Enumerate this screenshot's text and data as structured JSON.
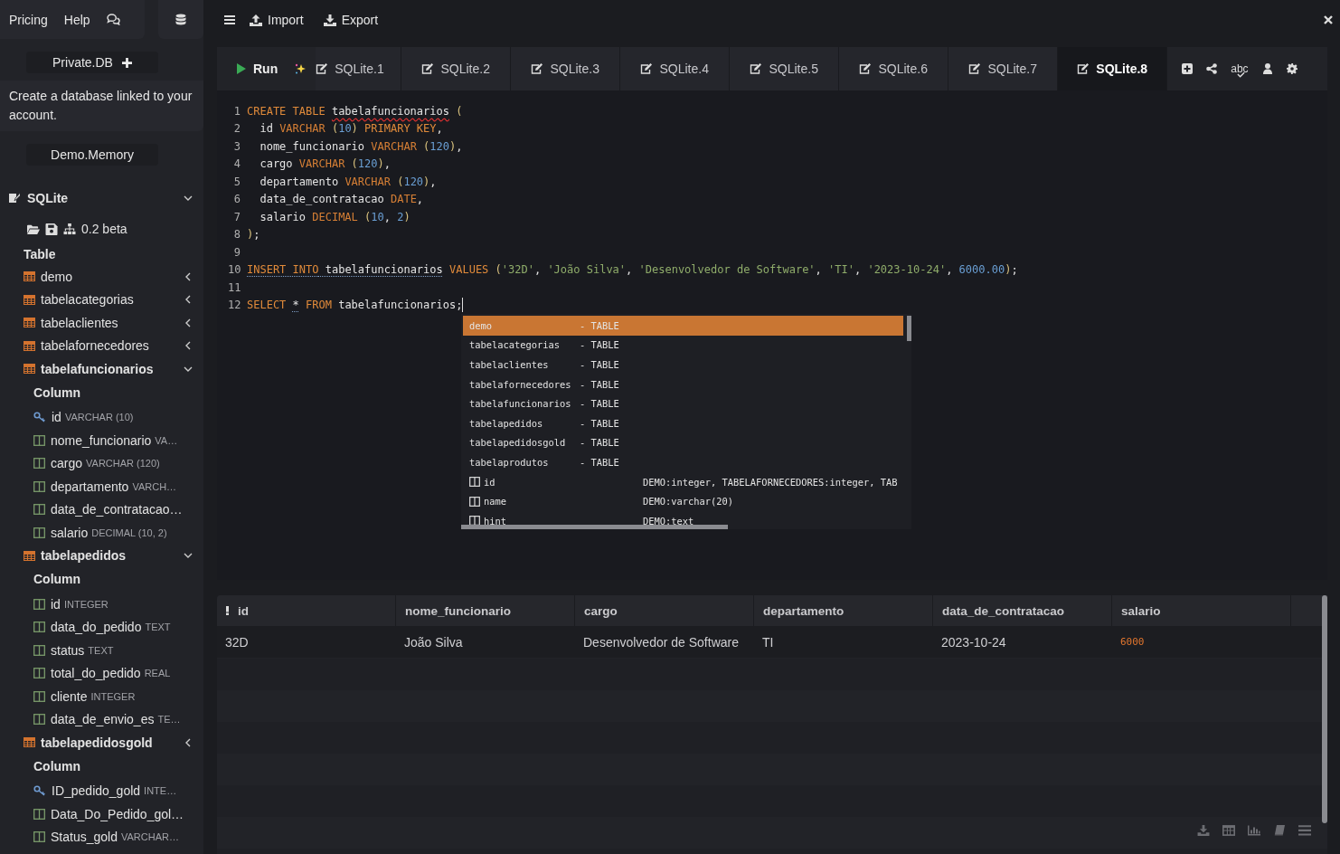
{
  "sidebar": {
    "links": [
      "Pricing",
      "Help"
    ],
    "private_db": {
      "label": "Private.DB",
      "description": "Create a database linked to your account."
    },
    "demo_button": "Demo.Memory",
    "database": {
      "name": "SQLite",
      "expanded": true,
      "version": "0.2 beta",
      "section": "Table",
      "tables": [
        {
          "name": "demo",
          "expanded": false
        },
        {
          "name": "tabelacategorias",
          "expanded": false
        },
        {
          "name": "tabelaclientes",
          "expanded": false
        },
        {
          "name": "tabelafornecedores",
          "expanded": false
        },
        {
          "name": "tabelafuncionarios",
          "expanded": true,
          "column_header": "Column",
          "columns": [
            {
              "name": "id",
              "type": "VARCHAR (10)",
              "key": true
            },
            {
              "name": "nome_funcionario",
              "type": "VA…",
              "key": false
            },
            {
              "name": "cargo",
              "type": "VARCHAR (120)",
              "key": false
            },
            {
              "name": "departamento",
              "type": "VARCH…",
              "key": false
            },
            {
              "name": "data_de_contratacao…",
              "key": false
            },
            {
              "name": "salario",
              "type": "DECIMAL (10, 2)",
              "key": false
            }
          ]
        },
        {
          "name": "tabelapedidos",
          "expanded": true,
          "column_header": "Column",
          "columns": [
            {
              "name": "id",
              "type": "INTEGER",
              "key": false
            },
            {
              "name": "data_do_pedido",
              "type": "TEXT",
              "key": false
            },
            {
              "name": "status",
              "type": "TEXT",
              "key": false
            },
            {
              "name": "total_do_pedido",
              "type": "REAL",
              "key": false
            },
            {
              "name": "cliente",
              "type": "INTEGER",
              "key": false
            },
            {
              "name": "data_de_envio_es",
              "type": "TE…",
              "key": false
            }
          ]
        },
        {
          "name": "tabelapedidosgold",
          "expanded": false,
          "column_header": "Column",
          "columns": [
            {
              "name": "ID_pedido_gold",
              "type": "INTE…",
              "key": true
            },
            {
              "name": "Data_Do_Pedido_gol…",
              "key": false
            },
            {
              "name": "Status_gold",
              "type": "VARCHAR…",
              "key": false
            }
          ]
        }
      ]
    }
  },
  "toolbar": {
    "import": "Import",
    "export": "Export"
  },
  "editor": {
    "run": "Run",
    "spellcheck": "abc",
    "tabs": [
      {
        "label": "SQLite.1",
        "selected": false
      },
      {
        "label": "SQLite.2",
        "selected": false
      },
      {
        "label": "SQLite.3",
        "selected": false
      },
      {
        "label": "SQLite.4",
        "selected": false
      },
      {
        "label": "SQLite.5",
        "selected": false
      },
      {
        "label": "SQLite.6",
        "selected": false
      },
      {
        "label": "SQLite.7",
        "selected": false
      },
      {
        "label": "SQLite.8",
        "selected": true
      }
    ],
    "lines": [
      {
        "n": "1",
        "tokens": [
          {
            "t": "CREATE TABLE ",
            "kind": "keyword"
          },
          {
            "t": "tabelafuncionarios",
            "kind": "plain",
            "error": true
          },
          {
            "t": " (",
            "kind": "paren"
          }
        ]
      },
      {
        "n": "2",
        "tokens": [
          {
            "t": "  id ",
            "kind": "plain"
          },
          {
            "t": "VARCHAR ",
            "kind": "type"
          },
          {
            "t": "(",
            "kind": "paren"
          },
          {
            "t": "10",
            "kind": "number"
          },
          {
            "t": ") ",
            "kind": "paren"
          },
          {
            "t": "PRIMARY KEY",
            "kind": "keyword"
          },
          {
            "t": ",",
            "kind": "plain"
          }
        ]
      },
      {
        "n": "3",
        "tokens": [
          {
            "t": "  nome_funcionario ",
            "kind": "plain"
          },
          {
            "t": "VARCHAR ",
            "kind": "type"
          },
          {
            "t": "(",
            "kind": "paren"
          },
          {
            "t": "120",
            "kind": "number"
          },
          {
            "t": ")",
            "kind": "paren"
          },
          {
            "t": ",",
            "kind": "plain"
          }
        ]
      },
      {
        "n": "4",
        "tokens": [
          {
            "t": "  cargo ",
            "kind": "plain"
          },
          {
            "t": "VARCHAR ",
            "kind": "type"
          },
          {
            "t": "(",
            "kind": "paren"
          },
          {
            "t": "120",
            "kind": "number"
          },
          {
            "t": ")",
            "kind": "paren"
          },
          {
            "t": ",",
            "kind": "plain"
          }
        ]
      },
      {
        "n": "5",
        "tokens": [
          {
            "t": "  departamento ",
            "kind": "plain"
          },
          {
            "t": "VARCHAR ",
            "kind": "type"
          },
          {
            "t": "(",
            "kind": "paren"
          },
          {
            "t": "120",
            "kind": "number"
          },
          {
            "t": ")",
            "kind": "paren"
          },
          {
            "t": ",",
            "kind": "plain"
          }
        ]
      },
      {
        "n": "6",
        "tokens": [
          {
            "t": "  data_de_contratacao ",
            "kind": "plain"
          },
          {
            "t": "DATE",
            "kind": "type"
          },
          {
            "t": ",",
            "kind": "plain"
          }
        ]
      },
      {
        "n": "7",
        "tokens": [
          {
            "t": "  salario ",
            "kind": "plain"
          },
          {
            "t": "DECIMAL ",
            "kind": "type"
          },
          {
            "t": "(",
            "kind": "paren"
          },
          {
            "t": "10",
            "kind": "number"
          },
          {
            "t": ", ",
            "kind": "plain"
          },
          {
            "t": "2",
            "kind": "number"
          },
          {
            "t": ")",
            "kind": "paren"
          }
        ]
      },
      {
        "n": "8",
        "tokens": [
          {
            "t": ")",
            "kind": "paren"
          },
          {
            "t": ";",
            "kind": "plain"
          }
        ]
      },
      {
        "n": "9"
      },
      {
        "n": "10",
        "tokens": [
          {
            "t": "INSERT INTO",
            "kind": "keyword",
            "hinted": true
          },
          {
            "t": " tabelafuncionarios",
            "kind": "plain",
            "hinted": true
          },
          {
            "t": " VALUES ",
            "kind": "keyword"
          },
          {
            "t": "(",
            "kind": "paren"
          },
          {
            "t": "'32D'",
            "kind": "string"
          },
          {
            "t": ", ",
            "kind": "plain"
          },
          {
            "t": "'João Silva'",
            "kind": "string"
          },
          {
            "t": ", ",
            "kind": "plain"
          },
          {
            "t": "'Desenvolvedor de Software'",
            "kind": "string"
          },
          {
            "t": ", ",
            "kind": "plain"
          },
          {
            "t": "'TI'",
            "kind": "string"
          },
          {
            "t": ", ",
            "kind": "plain"
          },
          {
            "t": "'2023-10-24'",
            "kind": "string"
          },
          {
            "t": ", ",
            "kind": "plain"
          },
          {
            "t": "6000.00",
            "kind": "number"
          },
          {
            "t": ")",
            "kind": "paren"
          },
          {
            "t": ";",
            "kind": "plain"
          }
        ]
      },
      {
        "n": "11"
      },
      {
        "n": "12",
        "cursor": true,
        "tokens": [
          {
            "t": "SELECT ",
            "kind": "keyword"
          },
          {
            "t": "*",
            "kind": "plain",
            "hinted": true
          },
          {
            "t": " FROM ",
            "kind": "keyword"
          },
          {
            "t": "tabelafuncionarios;",
            "kind": "plain"
          }
        ]
      }
    ],
    "autocomplete": [
      {
        "kind": "table",
        "name": "demo",
        "detail": "- TABLE",
        "selected": true
      },
      {
        "kind": "table",
        "name": "tabelacategorias",
        "detail": "- TABLE",
        "selected": false
      },
      {
        "kind": "table",
        "name": "tabelaclientes",
        "detail": "- TABLE",
        "selected": false
      },
      {
        "kind": "table",
        "name": "tabelafornecedores",
        "detail": "- TABLE",
        "selected": false
      },
      {
        "kind": "table",
        "name": "tabelafuncionarios",
        "detail": "- TABLE",
        "selected": false
      },
      {
        "kind": "table",
        "name": "tabelapedidos",
        "detail": "- TABLE",
        "selected": false
      },
      {
        "kind": "table",
        "name": "tabelapedidosgold",
        "detail": "- TABLE",
        "selected": false
      },
      {
        "kind": "table",
        "name": "tabelaprodutos",
        "detail": "- TABLE",
        "selected": false
      },
      {
        "kind": "column",
        "name": "id",
        "detail": "DEMO:integer, TABELAFORNECEDORES:integer, TAB",
        "selected": false
      },
      {
        "kind": "column",
        "name": "name",
        "detail": "DEMO:varchar(20)",
        "selected": false
      },
      {
        "kind": "column",
        "name": "hint",
        "detail": "DEMO:text",
        "selected": false
      }
    ]
  },
  "results": {
    "columns": [
      {
        "name": "id",
        "kind": "text"
      },
      {
        "name": "nome_funcionario",
        "kind": "text"
      },
      {
        "name": "cargo",
        "kind": "text"
      },
      {
        "name": "departamento",
        "kind": "text"
      },
      {
        "name": "data_de_contratacao",
        "kind": "text"
      },
      {
        "name": "salario",
        "kind": "number"
      }
    ],
    "rows": [
      [
        "32D",
        "João Silva",
        "Desenvolvedor de Software",
        "TI",
        "2023-10-24",
        "6000"
      ]
    ]
  }
}
